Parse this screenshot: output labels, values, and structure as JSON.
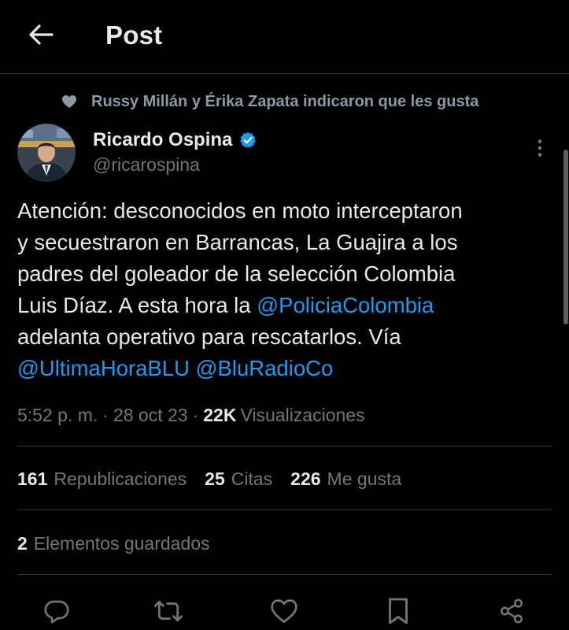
{
  "header": {
    "title": "Post",
    "back_icon": "arrow-left-icon"
  },
  "social_context": {
    "icon": "heart-icon",
    "text": "Russy Millán y Érika Zapata indicaron que les gusta"
  },
  "author": {
    "name": "Ricardo Ospina",
    "handle": "@ricarospina",
    "verified": true,
    "verified_icon": "verified-badge-icon"
  },
  "tweet": {
    "lines": [
      [
        {
          "t": "Atención: desconocidos en moto interceptaron"
        }
      ],
      [
        {
          "t": "y secuestraron en Barrancas, La Guajira a los"
        }
      ],
      [
        {
          "t": "padres del goleador de la selección Colombia"
        }
      ],
      [
        {
          "t": "Luis Díaz. A esta hora la "
        },
        {
          "t": "@PoliciaColombia",
          "mention": true
        }
      ],
      [
        {
          "t": "adelanta operativo para rescatarlos. Vía"
        }
      ],
      [
        {
          "t": "@UltimaHoraBLU",
          "mention": true
        },
        {
          "t": " "
        },
        {
          "t": "@BluRadioCo",
          "mention": true
        }
      ]
    ]
  },
  "meta": {
    "time": "5:52 p. m.",
    "separator": "·",
    "date": "28 oct 23",
    "views_count": "22K",
    "views_label": "Visualizaciones"
  },
  "stats": {
    "reposts_count": "161",
    "reposts_label": "Republicaciones",
    "quotes_count": "25",
    "quotes_label": "Citas",
    "likes_count": "226",
    "likes_label": "Me gusta"
  },
  "bookmarks": {
    "count": "2",
    "label": "Elementos guardados"
  },
  "actions": [
    "reply-icon",
    "repost-icon",
    "like-icon",
    "bookmark-icon",
    "share-icon"
  ],
  "colors": {
    "background": "#000000",
    "text_primary": "#e7e9ea",
    "text_secondary": "#71767b",
    "accent": "#1d9bf0",
    "divider": "#2f3336"
  }
}
